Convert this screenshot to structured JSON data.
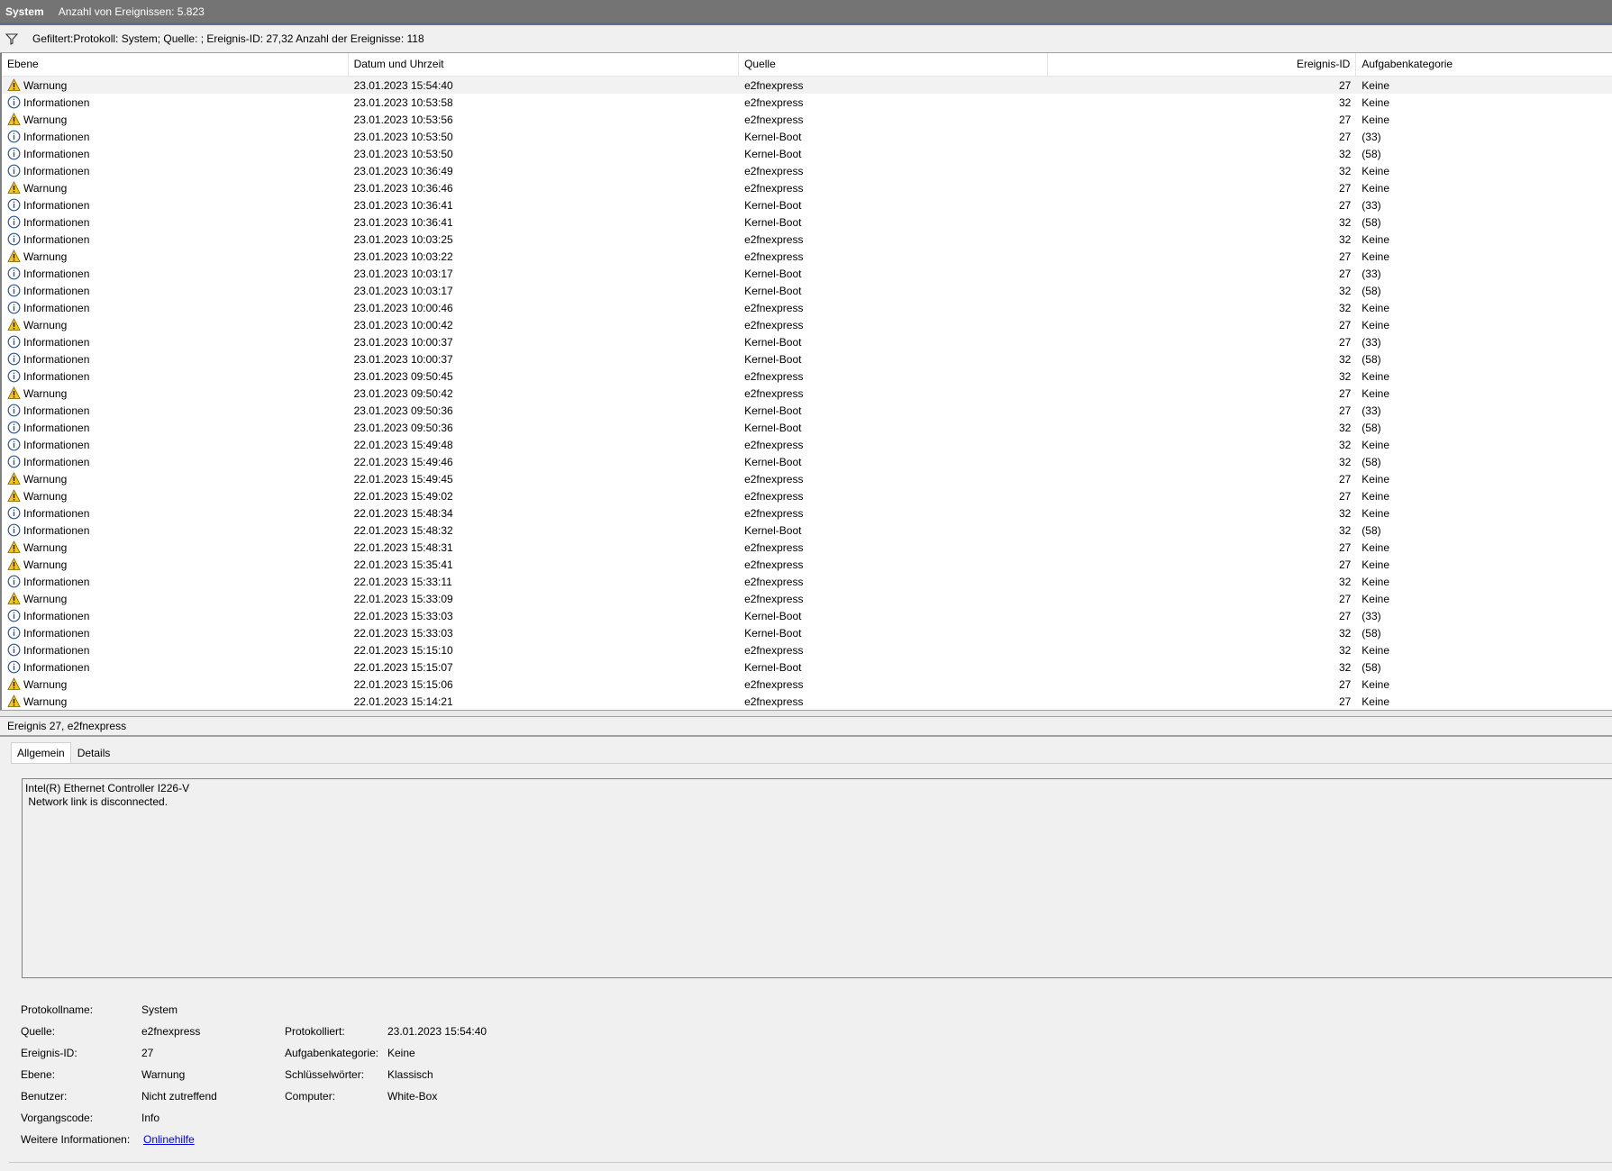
{
  "window": {
    "log_name": "System",
    "event_count_text": "Anzahl von Ereignissen: 5.823"
  },
  "filter": {
    "icon": "filter-icon",
    "text": "Gefiltert:Protokoll: System; Quelle: ; Ereignis-ID: 27,32 Anzahl der Ereignisse: 118"
  },
  "columns": [
    "Ebene",
    "Datum und Uhrzeit",
    "Quelle",
    "Ereignis-ID",
    "Aufgabenkategorie"
  ],
  "events": [
    {
      "level": "Warnung",
      "icon": "warning-icon",
      "date": "23.01.2023 15:54:40",
      "source": "e2fnexpress",
      "id": "27",
      "category": "Keine"
    },
    {
      "level": "Informationen",
      "icon": "info-icon",
      "date": "23.01.2023 10:53:58",
      "source": "e2fnexpress",
      "id": "32",
      "category": "Keine"
    },
    {
      "level": "Warnung",
      "icon": "warning-icon",
      "date": "23.01.2023 10:53:56",
      "source": "e2fnexpress",
      "id": "27",
      "category": "Keine"
    },
    {
      "level": "Informationen",
      "icon": "info-icon",
      "date": "23.01.2023 10:53:50",
      "source": "Kernel-Boot",
      "id": "27",
      "category": "(33)"
    },
    {
      "level": "Informationen",
      "icon": "info-icon",
      "date": "23.01.2023 10:53:50",
      "source": "Kernel-Boot",
      "id": "32",
      "category": "(58)"
    },
    {
      "level": "Informationen",
      "icon": "info-icon",
      "date": "23.01.2023 10:36:49",
      "source": "e2fnexpress",
      "id": "32",
      "category": "Keine"
    },
    {
      "level": "Warnung",
      "icon": "warning-icon",
      "date": "23.01.2023 10:36:46",
      "source": "e2fnexpress",
      "id": "27",
      "category": "Keine"
    },
    {
      "level": "Informationen",
      "icon": "info-icon",
      "date": "23.01.2023 10:36:41",
      "source": "Kernel-Boot",
      "id": "27",
      "category": "(33)"
    },
    {
      "level": "Informationen",
      "icon": "info-icon",
      "date": "23.01.2023 10:36:41",
      "source": "Kernel-Boot",
      "id": "32",
      "category": "(58)"
    },
    {
      "level": "Informationen",
      "icon": "info-icon",
      "date": "23.01.2023 10:03:25",
      "source": "e2fnexpress",
      "id": "32",
      "category": "Keine"
    },
    {
      "level": "Warnung",
      "icon": "warning-icon",
      "date": "23.01.2023 10:03:22",
      "source": "e2fnexpress",
      "id": "27",
      "category": "Keine"
    },
    {
      "level": "Informationen",
      "icon": "info-icon",
      "date": "23.01.2023 10:03:17",
      "source": "Kernel-Boot",
      "id": "27",
      "category": "(33)"
    },
    {
      "level": "Informationen",
      "icon": "info-icon",
      "date": "23.01.2023 10:03:17",
      "source": "Kernel-Boot",
      "id": "32",
      "category": "(58)"
    },
    {
      "level": "Informationen",
      "icon": "info-icon",
      "date": "23.01.2023 10:00:46",
      "source": "e2fnexpress",
      "id": "32",
      "category": "Keine"
    },
    {
      "level": "Warnung",
      "icon": "warning-icon",
      "date": "23.01.2023 10:00:42",
      "source": "e2fnexpress",
      "id": "27",
      "category": "Keine"
    },
    {
      "level": "Informationen",
      "icon": "info-icon",
      "date": "23.01.2023 10:00:37",
      "source": "Kernel-Boot",
      "id": "27",
      "category": "(33)"
    },
    {
      "level": "Informationen",
      "icon": "info-icon",
      "date": "23.01.2023 10:00:37",
      "source": "Kernel-Boot",
      "id": "32",
      "category": "(58)"
    },
    {
      "level": "Informationen",
      "icon": "info-icon",
      "date": "23.01.2023 09:50:45",
      "source": "e2fnexpress",
      "id": "32",
      "category": "Keine"
    },
    {
      "level": "Warnung",
      "icon": "warning-icon",
      "date": "23.01.2023 09:50:42",
      "source": "e2fnexpress",
      "id": "27",
      "category": "Keine"
    },
    {
      "level": "Informationen",
      "icon": "info-icon",
      "date": "23.01.2023 09:50:36",
      "source": "Kernel-Boot",
      "id": "27",
      "category": "(33)"
    },
    {
      "level": "Informationen",
      "icon": "info-icon",
      "date": "23.01.2023 09:50:36",
      "source": "Kernel-Boot",
      "id": "32",
      "category": "(58)"
    },
    {
      "level": "Informationen",
      "icon": "info-icon",
      "date": "22.01.2023 15:49:48",
      "source": "e2fnexpress",
      "id": "32",
      "category": "Keine"
    },
    {
      "level": "Informationen",
      "icon": "info-icon",
      "date": "22.01.2023 15:49:46",
      "source": "Kernel-Boot",
      "id": "32",
      "category": "(58)"
    },
    {
      "level": "Warnung",
      "icon": "warning-icon",
      "date": "22.01.2023 15:49:45",
      "source": "e2fnexpress",
      "id": "27",
      "category": "Keine"
    },
    {
      "level": "Warnung",
      "icon": "warning-icon",
      "date": "22.01.2023 15:49:02",
      "source": "e2fnexpress",
      "id": "27",
      "category": "Keine"
    },
    {
      "level": "Informationen",
      "icon": "info-icon",
      "date": "22.01.2023 15:48:34",
      "source": "e2fnexpress",
      "id": "32",
      "category": "Keine"
    },
    {
      "level": "Informationen",
      "icon": "info-icon",
      "date": "22.01.2023 15:48:32",
      "source": "Kernel-Boot",
      "id": "32",
      "category": "(58)"
    },
    {
      "level": "Warnung",
      "icon": "warning-icon",
      "date": "22.01.2023 15:48:31",
      "source": "e2fnexpress",
      "id": "27",
      "category": "Keine"
    },
    {
      "level": "Warnung",
      "icon": "warning-icon",
      "date": "22.01.2023 15:35:41",
      "source": "e2fnexpress",
      "id": "27",
      "category": "Keine"
    },
    {
      "level": "Informationen",
      "icon": "info-icon",
      "date": "22.01.2023 15:33:11",
      "source": "e2fnexpress",
      "id": "32",
      "category": "Keine"
    },
    {
      "level": "Warnung",
      "icon": "warning-icon",
      "date": "22.01.2023 15:33:09",
      "source": "e2fnexpress",
      "id": "27",
      "category": "Keine"
    },
    {
      "level": "Informationen",
      "icon": "info-icon",
      "date": "22.01.2023 15:33:03",
      "source": "Kernel-Boot",
      "id": "27",
      "category": "(33)"
    },
    {
      "level": "Informationen",
      "icon": "info-icon",
      "date": "22.01.2023 15:33:03",
      "source": "Kernel-Boot",
      "id": "32",
      "category": "(58)"
    },
    {
      "level": "Informationen",
      "icon": "info-icon",
      "date": "22.01.2023 15:15:10",
      "source": "e2fnexpress",
      "id": "32",
      "category": "Keine"
    },
    {
      "level": "Informationen",
      "icon": "info-icon",
      "date": "22.01.2023 15:15:07",
      "source": "Kernel-Boot",
      "id": "32",
      "category": "(58)"
    },
    {
      "level": "Warnung",
      "icon": "warning-icon",
      "date": "22.01.2023 15:15:06",
      "source": "e2fnexpress",
      "id": "27",
      "category": "Keine"
    },
    {
      "level": "Warnung",
      "icon": "warning-icon",
      "date": "22.01.2023 15:14:21",
      "source": "e2fnexpress",
      "id": "27",
      "category": "Keine"
    }
  ],
  "detail": {
    "header": "Ereignis 27, e2fnexpress",
    "tabs": [
      "Allgemein",
      "Details"
    ],
    "message": "Intel(R) Ethernet Controller I226-V\n Network link is disconnected.",
    "props_left": [
      {
        "label": "Protokollname:",
        "value": "System"
      },
      {
        "label": "Quelle:",
        "value": "e2fnexpress"
      },
      {
        "label": "Ereignis-ID:",
        "value": "27"
      },
      {
        "label": "Ebene:",
        "value": "Warnung"
      },
      {
        "label": "Benutzer:",
        "value": "Nicht zutreffend"
      },
      {
        "label": "Vorgangscode:",
        "value": "Info"
      },
      {
        "label": "Weitere Informationen:",
        "value": "Onlinehilfe"
      }
    ],
    "props_right": [
      {
        "label": "Protokolliert:",
        "value": "23.01.2023 15:54:40"
      },
      {
        "label": "Aufgabenkategorie:",
        "value": "Keine"
      },
      {
        "label": "Schlüsselwörter:",
        "value": "Klassisch"
      },
      {
        "label": "Computer:",
        "value": "White-Box"
      }
    ]
  },
  "colors": {
    "titlebar": "#747474",
    "warning": "#f5c518",
    "info": "#2b5797",
    "link": "#0000ee"
  }
}
